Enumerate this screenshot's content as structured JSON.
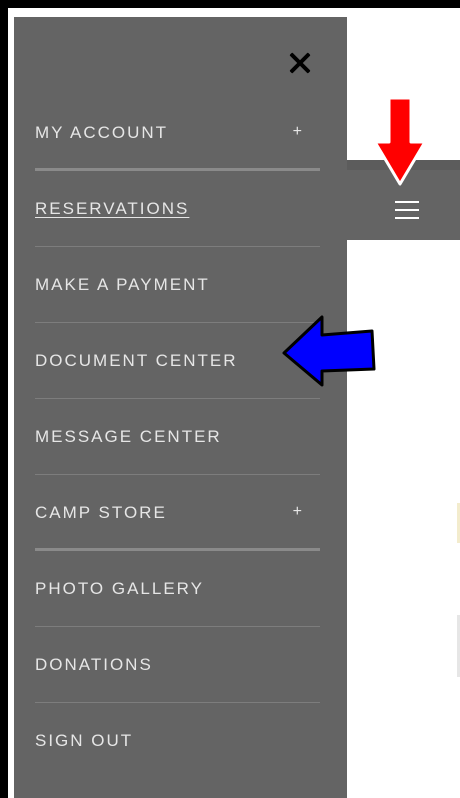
{
  "menu": {
    "items": [
      {
        "label": "MY ACCOUNT",
        "expand": "+"
      },
      {
        "label": "RESERVATIONS",
        "expand": null
      },
      {
        "label": "MAKE A PAYMENT",
        "expand": null
      },
      {
        "label": "DOCUMENT CENTER",
        "expand": null
      },
      {
        "label": "MESSAGE CENTER",
        "expand": null
      },
      {
        "label": "CAMP STORE",
        "expand": "+"
      },
      {
        "label": "PHOTO GALLERY",
        "expand": null
      },
      {
        "label": "DONATIONS",
        "expand": null
      },
      {
        "label": "SIGN OUT",
        "expand": null
      }
    ]
  },
  "colors": {
    "drawer_bg": "#646464",
    "menu_text": "#e6e6e6",
    "red_arrow": "#ff0000",
    "blue_arrow": "#0000ff"
  },
  "icons": {
    "close": "close-icon",
    "menu": "hamburger-menu-icon"
  }
}
